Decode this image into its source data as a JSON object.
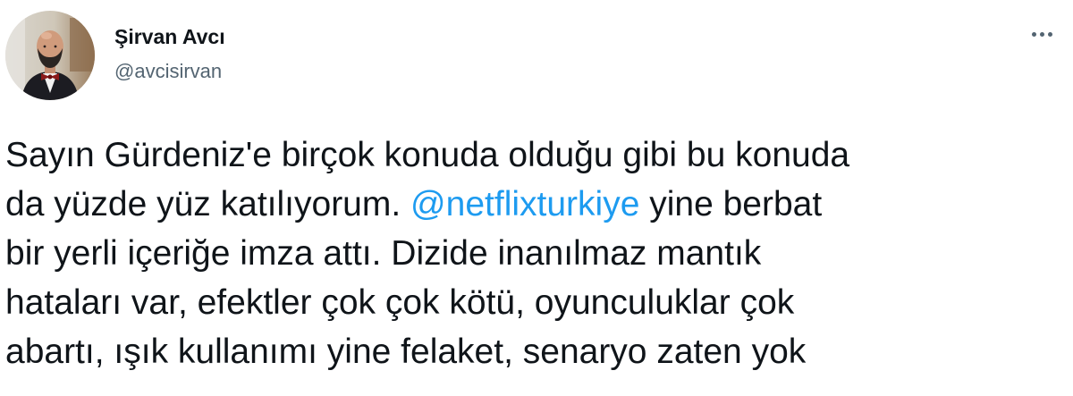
{
  "author": {
    "name": "Şirvan Avcı",
    "handle": "@avcisirvan",
    "avatar_icon": "profile-photo"
  },
  "menu": {
    "more_icon": "more-horizontal-icon"
  },
  "tweet": {
    "lines": [
      {
        "text": "Sayın Gürdeniz'e birçok konuda olduğu gibi bu konuda"
      },
      {
        "pre": "da yüzde yüz katılıyorum. ",
        "mention": "@netflixturkiye",
        "post": " yine berbat"
      },
      {
        "text": "bir yerli içeriğe imza attı. Dizide inanılmaz mantık"
      },
      {
        "text": "hataları var, efektler çok çok kötü, oyunculuklar çok"
      },
      {
        "text": "abartı, ışık kullanımı yine felaket, senaryo zaten yok"
      }
    ]
  },
  "colors": {
    "text": "#0f1419",
    "secondary_text": "#536471",
    "link": "#1d9bf0",
    "background": "#ffffff"
  }
}
